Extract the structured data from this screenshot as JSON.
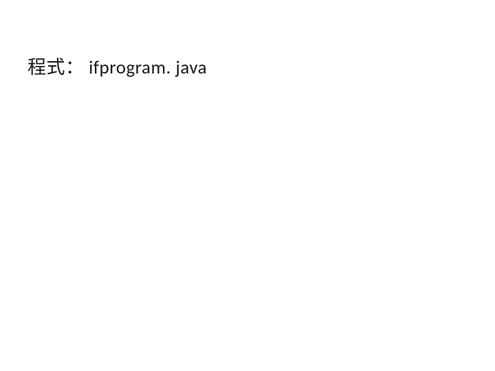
{
  "slide": {
    "label": "程式：",
    "filename": "ifprogram. java"
  }
}
